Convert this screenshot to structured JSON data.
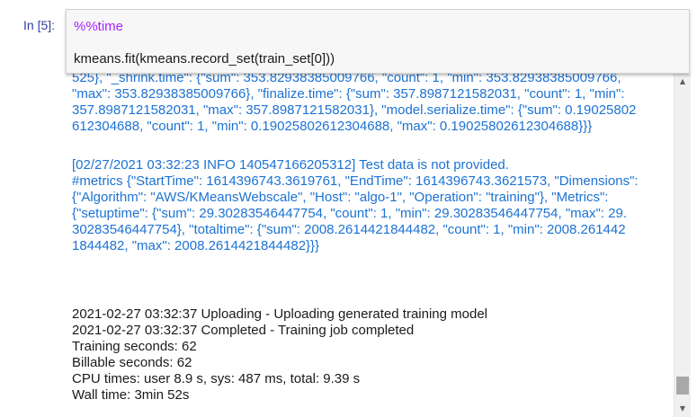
{
  "cell": {
    "prompt": "In [5]:",
    "code_line1_magic": "%%time",
    "code_line2": "kmeans.fit(kmeans.record_set(train_set[0]))"
  },
  "output": {
    "log_lines": [
      "525}, \"_shrink.time\": {\"sum\": 353.82938385009766, \"count\": 1, \"min\": 353.82938385009766,",
      "\"max\": 353.82938385009766}, \"finalize.time\": {\"sum\": 357.8987121582031, \"count\": 1, \"min\":",
      "357.8987121582031, \"max\": 357.8987121582031}, \"model.serialize.time\": {\"sum\": 0.19025802",
      "612304688, \"count\": 1, \"min\": 0.19025802612304688, \"max\": 0.19025802612304688}}}",
      "",
      "[02/27/2021 03:32:23 INFO 140547166205312] Test data is not provided.",
      "#metrics {\"StartTime\": 1614396743.3619761, \"EndTime\": 1614396743.3621573, \"Dimensions\":",
      "{\"Algorithm\": \"AWS/KMeansWebscale\", \"Host\": \"algo-1\", \"Operation\": \"training\"}, \"Metrics\":",
      "{\"setuptime\": {\"sum\": 29.30283546447754, \"count\": 1, \"min\": 29.30283546447754, \"max\": 29.",
      "30283546447754}, \"totaltime\": {\"sum\": 2008.2614421844482, \"count\": 1, \"min\": 2008.261442",
      "1844482, \"max\": 2008.2614421844482}}}"
    ],
    "std_lines": [
      "2021-02-27 03:32:37 Uploading - Uploading generated training model",
      "2021-02-27 03:32:37 Completed - Training job completed",
      "Training seconds: 62",
      "Billable seconds: 62",
      "CPU times: user 8.9 s, sys: 487 ms, total: 9.39 s",
      "Wall time: 3min 52s"
    ]
  },
  "colors": {
    "log_text": "#1c72d4",
    "magic": "#aa22ff",
    "prompt": "#303f9f"
  }
}
